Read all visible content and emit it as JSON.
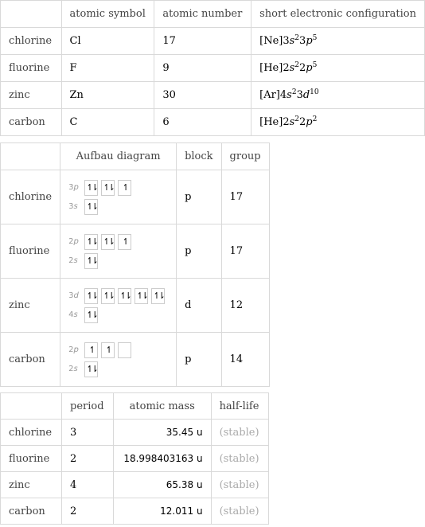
{
  "table1": {
    "headers": [
      "",
      "atomic symbol",
      "atomic number",
      "short electronic configuration"
    ],
    "rows": [
      {
        "name": "chlorine",
        "symbol": "Cl",
        "number": "17",
        "config": {
          "core": "[Ne]",
          "parts": [
            {
              "n": "3",
              "l": "s",
              "e": "2"
            },
            {
              "n": "3",
              "l": "p",
              "e": "5"
            }
          ]
        }
      },
      {
        "name": "fluorine",
        "symbol": "F",
        "number": "9",
        "config": {
          "core": "[He]",
          "parts": [
            {
              "n": "2",
              "l": "s",
              "e": "2"
            },
            {
              "n": "2",
              "l": "p",
              "e": "5"
            }
          ]
        }
      },
      {
        "name": "zinc",
        "symbol": "Zn",
        "number": "30",
        "config": {
          "core": "[Ar]",
          "parts": [
            {
              "n": "4",
              "l": "s",
              "e": "2"
            },
            {
              "n": "3",
              "l": "d",
              "e": "10"
            }
          ]
        }
      },
      {
        "name": "carbon",
        "symbol": "C",
        "number": "6",
        "config": {
          "core": "[He]",
          "parts": [
            {
              "n": "2",
              "l": "s",
              "e": "2"
            },
            {
              "n": "2",
              "l": "p",
              "e": "2"
            }
          ]
        }
      }
    ]
  },
  "table2": {
    "headers": [
      "",
      "Aufbau diagram",
      "block",
      "group"
    ],
    "rows": [
      {
        "name": "chlorine",
        "block": "p",
        "group": "17",
        "orbitals": [
          {
            "n": "3",
            "l": "p",
            "boxes": [
              "updown",
              "updown",
              "up"
            ]
          },
          {
            "n": "3",
            "l": "s",
            "boxes": [
              "updown"
            ]
          }
        ]
      },
      {
        "name": "fluorine",
        "block": "p",
        "group": "17",
        "orbitals": [
          {
            "n": "2",
            "l": "p",
            "boxes": [
              "updown",
              "updown",
              "up"
            ]
          },
          {
            "n": "2",
            "l": "s",
            "boxes": [
              "updown"
            ]
          }
        ]
      },
      {
        "name": "zinc",
        "block": "d",
        "group": "12",
        "orbitals": [
          {
            "n": "3",
            "l": "d",
            "boxes": [
              "updown",
              "updown",
              "updown",
              "updown",
              "updown"
            ]
          },
          {
            "n": "4",
            "l": "s",
            "boxes": [
              "updown"
            ]
          }
        ]
      },
      {
        "name": "carbon",
        "block": "p",
        "group": "14",
        "orbitals": [
          {
            "n": "2",
            "l": "p",
            "boxes": [
              "up",
              "up",
              "empty"
            ]
          },
          {
            "n": "2",
            "l": "s",
            "boxes": [
              "updown"
            ]
          }
        ]
      }
    ]
  },
  "table3": {
    "headers": [
      "",
      "period",
      "atomic mass",
      "half-life"
    ],
    "rows": [
      {
        "name": "chlorine",
        "period": "3",
        "mass": "35.45 u",
        "halflife": "(stable)"
      },
      {
        "name": "fluorine",
        "period": "2",
        "mass": "18.998403163 u",
        "halflife": "(stable)"
      },
      {
        "name": "zinc",
        "period": "4",
        "mass": "65.38 u",
        "halflife": "(stable)"
      },
      {
        "name": "carbon",
        "period": "2",
        "mass": "12.011 u",
        "halflife": "(stable)"
      }
    ]
  },
  "spin_glyphs": {
    "updown": "↿⇂",
    "up": "↿",
    "empty": ""
  }
}
